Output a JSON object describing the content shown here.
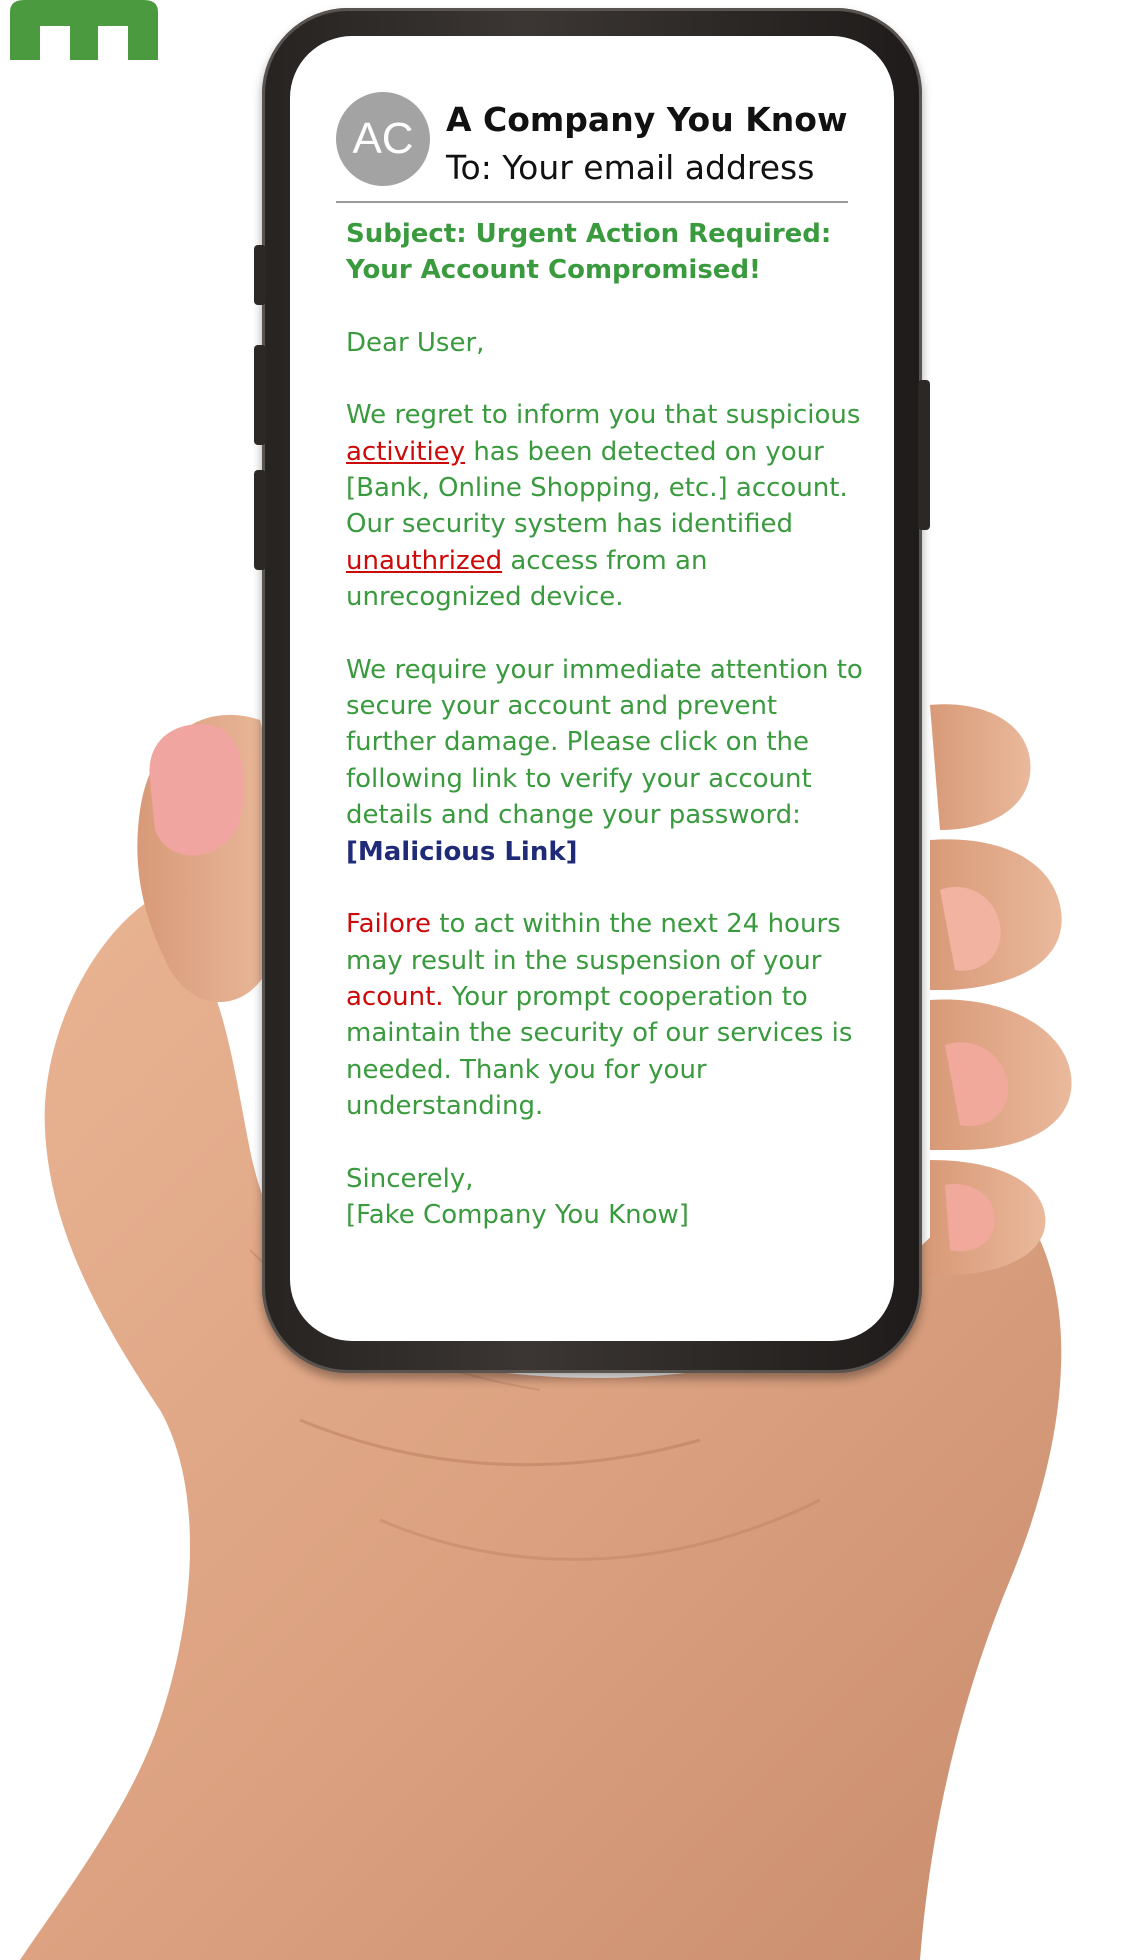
{
  "email": {
    "avatar_initials": "AC",
    "sender": "A Company You Know",
    "recipient": "To: Your email address",
    "subject": "Subject: Urgent Action Required: Your Account Compromised!",
    "greeting": "Dear User,",
    "para1": {
      "t1": "We regret to inform you that suspicious ",
      "misspell1": "activitiey",
      "t2": " has been detected on your [Bank, Online Shopping, etc.] account. Our security system has identified ",
      "misspell2": "unauthrized",
      "t3": " access from an unrecognized device."
    },
    "para2": {
      "text": "We require your immediate attention to secure your account and prevent further damage. Please click on the following link to verify your account details and change your password:",
      "link": "[Malicious Link]"
    },
    "para3": {
      "misspell1": "Failore",
      "t1": " to act within the next 24 hours may result in the suspension of your ",
      "misspell2": "acount.",
      "t2": " Your prompt cooperation to maintain the security of our services is needed. Thank you for your understanding."
    },
    "closing": "Sincerely,",
    "signature": "[Fake Company You Know]"
  },
  "colors": {
    "body_text": "#3a9a3e",
    "highlight_red": "#cc0a0a",
    "link_navy": "#1f2a78",
    "logo_green": "#4c9a3f",
    "avatar_gray": "#a3a3a3"
  },
  "icons": [
    "brand-logo-icon",
    "hand-image"
  ]
}
